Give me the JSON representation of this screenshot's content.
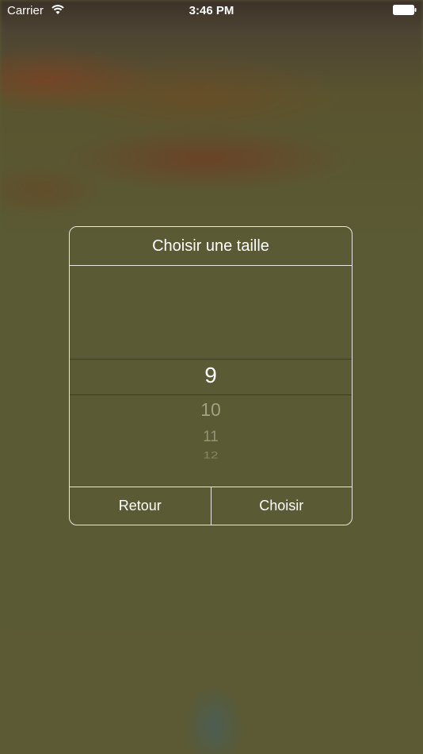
{
  "status_bar": {
    "carrier": "Carrier",
    "time": "3:46 PM",
    "wifi_icon": "wifi-icon",
    "battery_icon": "battery-icon"
  },
  "dialog": {
    "title": "Choisir une taille",
    "picker": {
      "items": [
        "9",
        "10",
        "11",
        "12"
      ],
      "selected": "9"
    },
    "back_label": "Retour",
    "choose_label": "Choisir"
  },
  "colors": {
    "background": "#5b5a35",
    "border": "#e8e8e0",
    "text": "#ffffff"
  }
}
